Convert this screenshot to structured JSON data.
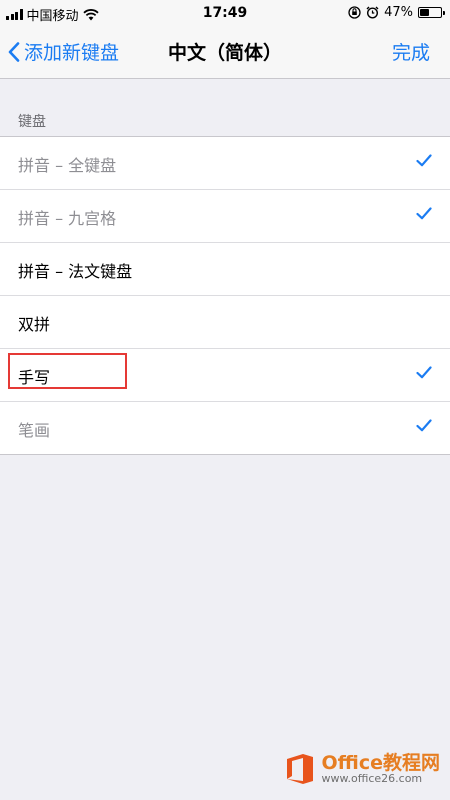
{
  "status_bar": {
    "carrier": "中国移动",
    "time": "17:49",
    "battery_text": "47%",
    "battery_level": 0.47
  },
  "nav": {
    "back_label": "添加新键盘",
    "title": "中文（简体）",
    "done_label": "完成"
  },
  "section": {
    "header": "键盘"
  },
  "keyboards": [
    {
      "label": "拼音 – 全键盘",
      "checked": true,
      "disabled": true
    },
    {
      "label": "拼音 – 九宫格",
      "checked": true,
      "disabled": true
    },
    {
      "label": "拼音 – 法文键盘",
      "checked": false,
      "disabled": false
    },
    {
      "label": "双拼",
      "checked": false,
      "disabled": false
    },
    {
      "label": "手写",
      "checked": true,
      "disabled": false
    },
    {
      "label": "笔画",
      "checked": true,
      "disabled": true
    }
  ],
  "watermark": {
    "title": "Office教程网",
    "url": "www.office26.com"
  },
  "colors": {
    "accent": "#1b7cf2",
    "highlight": "#e53935"
  }
}
